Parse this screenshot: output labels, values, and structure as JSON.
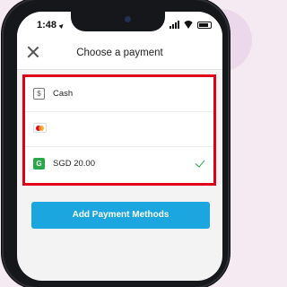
{
  "status_bar": {
    "time": "1:48"
  },
  "header": {
    "title": "Choose a payment"
  },
  "payment_options": [
    {
      "label": "Cash",
      "icon": "cash-icon",
      "icon_glyph": "$",
      "selected": false
    },
    {
      "label": "",
      "icon": "mastercard-icon",
      "selected": false
    },
    {
      "label": "SGD 20.00",
      "icon": "wallet-icon",
      "icon_glyph": "G",
      "selected": true
    }
  ],
  "actions": {
    "add_label": "Add Payment Methods"
  },
  "colors": {
    "accent": "#1ba6df",
    "highlight": "#e0001a",
    "check": "#22a64b",
    "wallet": "#2aa84a"
  }
}
